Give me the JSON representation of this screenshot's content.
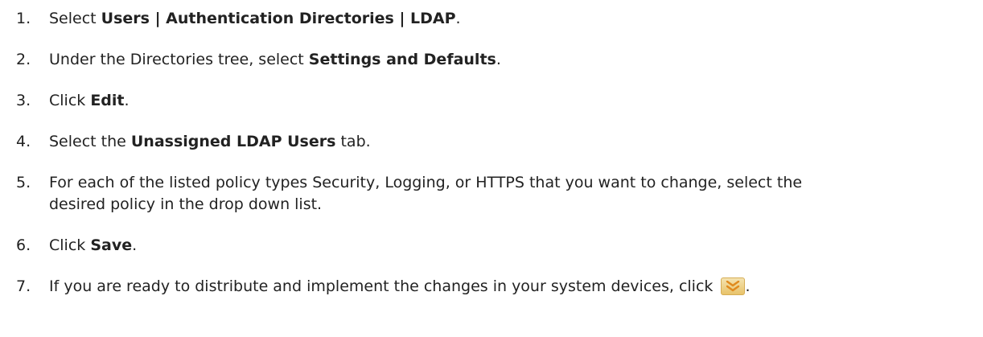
{
  "steps": [
    {
      "number": "1.",
      "pre": "Select ",
      "bold": "Users | Authentication Directories | LDAP",
      "post": "."
    },
    {
      "number": "2.",
      "pre": "Under the Directories tree, select ",
      "bold": "Settings and Defaults",
      "post": "."
    },
    {
      "number": "3.",
      "pre": "Click ",
      "bold": "Edit",
      "post": "."
    },
    {
      "number": "4.",
      "pre": "Select the ",
      "bold": "Unassigned LDAP Users",
      "post": " tab."
    },
    {
      "number": "5.",
      "line1": "For each of the listed policy types Security, Logging, or HTTPS that you want to change, select the",
      "line2": "desired policy in the drop down list."
    },
    {
      "number": "6.",
      "pre": "Click ",
      "bold": "Save",
      "post": "."
    },
    {
      "number": "7.",
      "pre": "If you are ready to distribute and implement the changes in your system devices, click ",
      "post": ".",
      "icon": "install-policy-icon"
    }
  ],
  "colors": {
    "text": "#222222",
    "icon_chevron": "#e08a1e",
    "icon_bg": "#f0d58f"
  }
}
